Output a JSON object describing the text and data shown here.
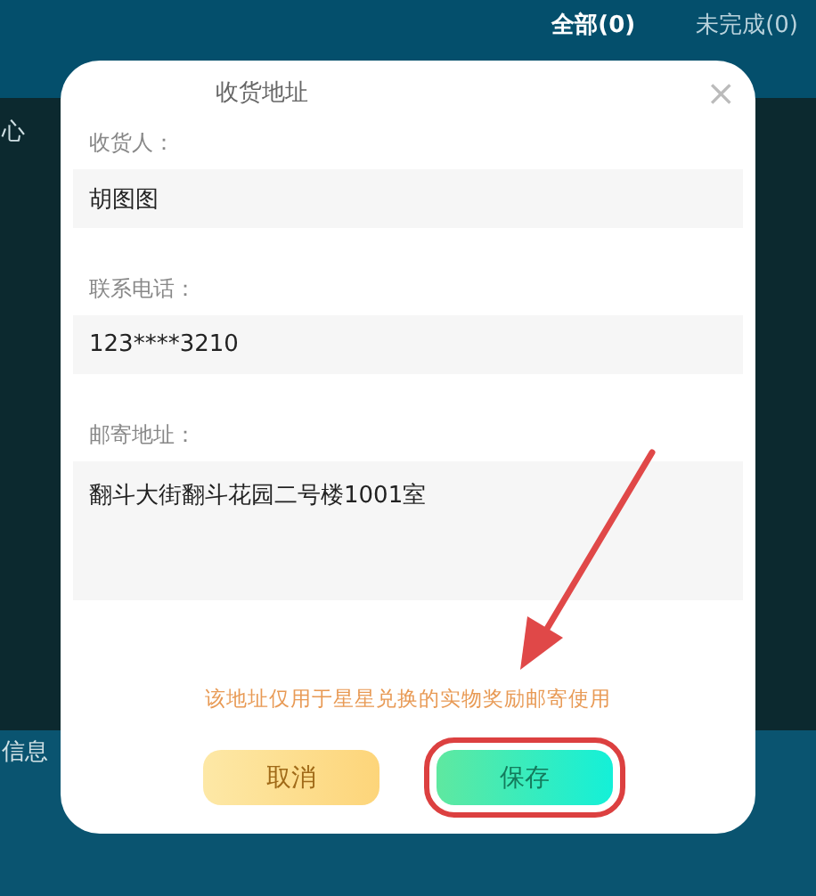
{
  "tabs": [
    {
      "label": "全部(0)",
      "selected": true
    },
    {
      "label": "未完成(0)",
      "selected": false
    }
  ],
  "side_items": [
    "心",
    "信息"
  ],
  "dialog": {
    "title": "收货地址",
    "close": "×",
    "fields": [
      {
        "label": "收货人：",
        "value": "胡图图",
        "kind": "input"
      },
      {
        "label": "联系电话：",
        "value": "123****3210",
        "kind": "input"
      },
      {
        "label": "邮寄地址：",
        "value": "翻斗大街翻斗花园二号楼1001室",
        "kind": "textarea"
      }
    ],
    "note": "该地址仅用于星星兑换的实物奖励邮寄使用",
    "buttons": [
      {
        "label": "取消",
        "kind": "cancel",
        "highlighted": false
      },
      {
        "label": "保存",
        "kind": "save",
        "highlighted": true
      }
    ]
  }
}
